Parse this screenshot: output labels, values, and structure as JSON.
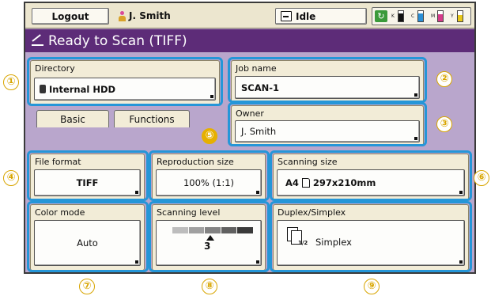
{
  "topbar": {
    "logout_label": "Logout",
    "user_name": "J. Smith",
    "status_label": "Idle",
    "ink": [
      {
        "letter": "K",
        "color": "#111111",
        "level": 0.8
      },
      {
        "letter": "C",
        "color": "#2a8fd6",
        "level": 0.75
      },
      {
        "letter": "M",
        "color": "#d63a8a",
        "level": 0.7
      },
      {
        "letter": "Y",
        "color": "#e8c81a",
        "level": 0.65
      }
    ]
  },
  "title": "Ready to Scan (TIFF)",
  "directory": {
    "label": "Directory",
    "value": "Internal HDD"
  },
  "job_name": {
    "label": "Job name",
    "value": "SCAN-1"
  },
  "owner": {
    "label": "Owner",
    "value": "J. Smith"
  },
  "tabs": [
    "Basic",
    "Functions"
  ],
  "file_format": {
    "label": "File format",
    "value": "TIFF"
  },
  "reproduction_size": {
    "label": "Reproduction size",
    "value": "100% (1:1)"
  },
  "scanning_size": {
    "label": "Scanning size",
    "paper": "A4",
    "value": "297x210mm"
  },
  "color_mode": {
    "label": "Color mode",
    "value": "Auto"
  },
  "scanning_level": {
    "label": "Scanning level",
    "value": "3"
  },
  "duplex": {
    "label": "Duplex/Simplex",
    "value": "Simplex",
    "icon_tag": "1/2"
  },
  "callouts": [
    "①",
    "②",
    "③",
    "④",
    "⑤",
    "⑥",
    "⑦",
    "⑧",
    "⑨"
  ],
  "colors": {
    "accent": "#2596d8",
    "title_bg": "#5d2c78",
    "screen_bg": "#b9a6cc",
    "panel_bg": "#f2ecd7",
    "callout": "#d8a500"
  }
}
